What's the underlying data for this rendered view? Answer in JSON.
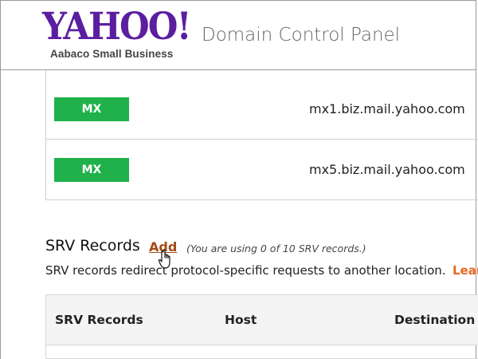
{
  "header": {
    "logo_text": "YAHOO!",
    "logo_subtitle": "Aabaco Small Business",
    "panel_title": "Domain Control Panel"
  },
  "mx_records": [
    {
      "type": "MX",
      "host": "mx1.biz.mail.yahoo.com"
    },
    {
      "type": "MX",
      "host": "mx5.biz.mail.yahoo.com"
    }
  ],
  "srv": {
    "title": "SRV Records",
    "add_label": "Add",
    "usage_text": "(You are using 0 of 10 SRV records.)",
    "description": "SRV records redirect protocol-specific requests to another location.",
    "learn_more": "Lear",
    "columns": [
      "SRV Records",
      "Host",
      "Destination"
    ]
  },
  "colors": {
    "brand_purple": "#5b1ea0",
    "mx_badge_green": "#20b14b",
    "add_link": "#a54a14",
    "learn_link": "#e8661f"
  },
  "icons": {
    "cursor": "hand-pointer-icon"
  }
}
